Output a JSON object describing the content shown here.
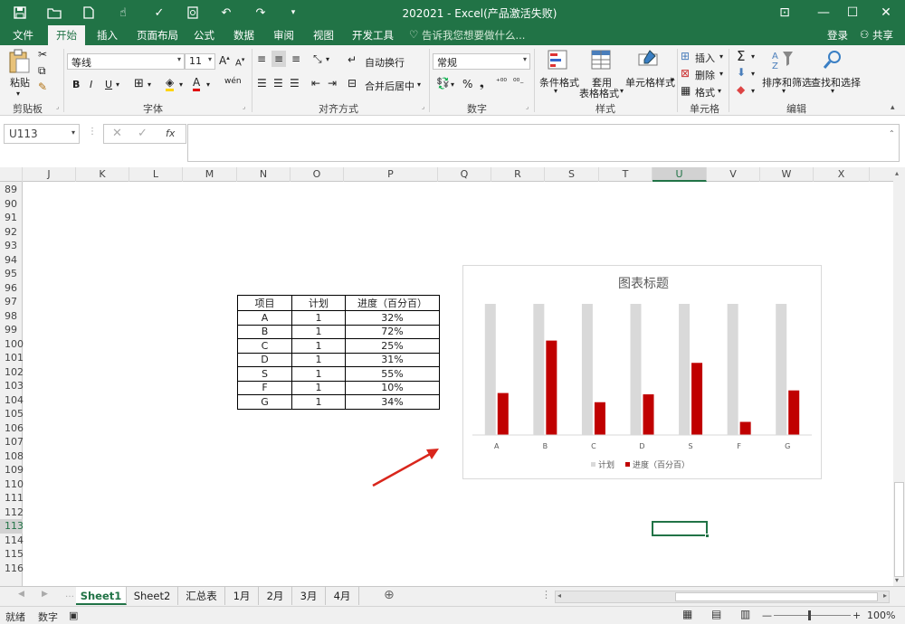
{
  "app": {
    "title": "202021 - Excel(产品激活失败)"
  },
  "menu": {
    "items": [
      "文件",
      "开始",
      "插入",
      "页面布局",
      "公式",
      "数据",
      "审阅",
      "视图",
      "开发工具"
    ],
    "active": "开始",
    "tell_me": "告诉我您想要做什么...",
    "login": "登录",
    "share": "共享"
  },
  "ribbon": {
    "clipboard": {
      "paste": "粘贴",
      "label": "剪贴板"
    },
    "font": {
      "name": "等线",
      "size": "11",
      "label": "字体",
      "bold": "B",
      "italic": "I",
      "underline": "U"
    },
    "alignment": {
      "wrap": "自动换行",
      "merge": "合并后居中",
      "label": "对齐方式"
    },
    "number": {
      "format": "常规",
      "label": "数字",
      "percent": "%"
    },
    "styles": {
      "conditional": "条件格式",
      "table1": "套用",
      "table2": "表格格式",
      "cell": "单元格样式",
      "label": "样式"
    },
    "cells": {
      "insert": "插入",
      "delete": "删除",
      "format": "格式",
      "label": "单元格"
    },
    "editing": {
      "sort": "排序和筛选",
      "find": "查找和选择",
      "label": "编辑"
    }
  },
  "formula_bar": {
    "name_box": "U113",
    "fx": "fx",
    "value": ""
  },
  "columns": [
    "J",
    "K",
    "L",
    "M",
    "N",
    "O",
    "P",
    "Q",
    "R",
    "S",
    "T",
    "U",
    "V",
    "W",
    "X"
  ],
  "selected_column": "U",
  "rows": [
    "89",
    "90",
    "91",
    "92",
    "93",
    "94",
    "95",
    "96",
    "97",
    "98",
    "99",
    "100",
    "101",
    "102",
    "103",
    "104",
    "105",
    "106",
    "107",
    "108",
    "109",
    "110",
    "111",
    "112",
    "113",
    "114",
    "115",
    "116"
  ],
  "selected_row": "113",
  "table": {
    "headers": [
      "项目",
      "计划",
      "进度（百分百）"
    ],
    "rows": [
      [
        "A",
        "1",
        "32%"
      ],
      [
        "B",
        "1",
        "72%"
      ],
      [
        "C",
        "1",
        "25%"
      ],
      [
        "D",
        "1",
        "31%"
      ],
      [
        "S",
        "1",
        "55%"
      ],
      [
        "F",
        "1",
        "10%"
      ],
      [
        "G",
        "1",
        "34%"
      ]
    ]
  },
  "chart_data": {
    "type": "bar",
    "title": "图表标题",
    "categories": [
      "A",
      "B",
      "C",
      "D",
      "S",
      "F",
      "G"
    ],
    "series": [
      {
        "name": "计划",
        "values": [
          1,
          1,
          1,
          1,
          1,
          1,
          1
        ],
        "color": "#d9d9d9"
      },
      {
        "name": "进度（百分百）",
        "values": [
          0.32,
          0.72,
          0.25,
          0.31,
          0.55,
          0.1,
          0.34
        ],
        "color": "#c00000"
      }
    ],
    "ylim": [
      0,
      1
    ],
    "grid": false,
    "legend": "bottom"
  },
  "sheets": [
    "Sheet1",
    "Sheet2",
    "汇总表",
    "1月",
    "2月",
    "3月",
    "4月"
  ],
  "active_sheet": "Sheet1",
  "status": {
    "ready": "就绪",
    "mode": "数字",
    "zoom": "100%"
  },
  "colors": {
    "accent": "#217346",
    "arrow": "#d9261c"
  }
}
